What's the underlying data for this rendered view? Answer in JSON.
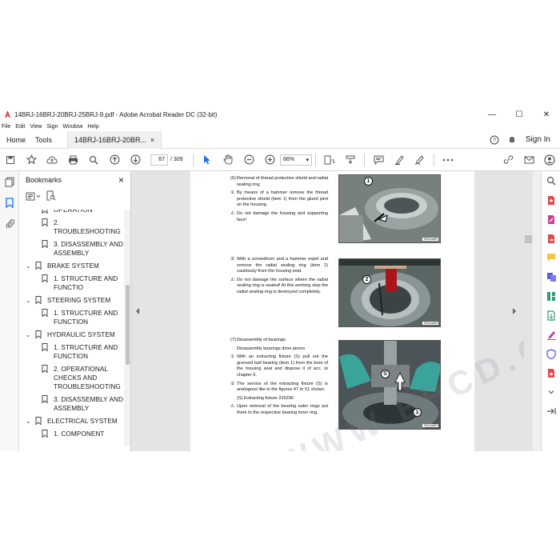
{
  "window": {
    "title": "14BRJ-16BRJ-20BRJ-25BRJ-9.pdf - Adobe Acrobat Reader DC (32-bit)",
    "controls": {
      "minimize": "—",
      "maximize": "☐",
      "close": "✕"
    }
  },
  "menu": [
    "File",
    "Edit",
    "View",
    "Sign",
    "Window",
    "Help"
  ],
  "tabs": {
    "home": "Home",
    "tools": "Tools",
    "document": "14BRJ-16BRJ-20BR...",
    "document_close": "×",
    "signin": "Sign In"
  },
  "toolbar": {
    "page_current": "67",
    "page_total": "/ 309",
    "zoom": "66%"
  },
  "bookmarks": {
    "title": "Bookmarks",
    "close": "×",
    "items": [
      {
        "level": 2,
        "label": "OPERATION"
      },
      {
        "level": 2,
        "label": "2. TROUBLESHOOTING"
      },
      {
        "level": 2,
        "label": "3. DISASSEMBLY AND ASSEMBLY"
      },
      {
        "level": 1,
        "label": "BRAKE SYSTEM"
      },
      {
        "level": 2,
        "label": "1. STRUCTURE AND FUNCTIO"
      },
      {
        "level": 1,
        "label": "STEERING SYSTEM"
      },
      {
        "level": 2,
        "label": "1. STRUCTURE AND FUNCTION"
      },
      {
        "level": 1,
        "label": "HYDRAULIC SYSTEM"
      },
      {
        "level": 2,
        "label": "1. STRUCTURE AND FUNCTION"
      },
      {
        "level": 2,
        "label": "2. OPERATIONAL CHECKS AND TROUBLESHOOTING"
      },
      {
        "level": 2,
        "label": "3. DISASSEMBLY AND ASSEMBLY"
      },
      {
        "level": 1,
        "label": "ELECTRICAL SYSTEM"
      },
      {
        "level": 2,
        "label": "1. COMPONENT"
      }
    ]
  },
  "document": {
    "watermark": "WWW.EPCD.COM",
    "blocks": [
      {
        "bullet": "(6)",
        "text": "Removal of thread protective shield and radial sealing ring"
      },
      {
        "bullet": "①",
        "text": "By means of a hammer remove the thread protective shield (item 1) from the glued joint on the housing."
      },
      {
        "bullet": "⚠",
        "text": "Do not damage the housing and supporting face!"
      },
      {
        "bullet": "②",
        "text": "With a screwdriver and a hammer expel and remove the radial sealing ring (item 2) cautiously from the housing seat."
      },
      {
        "bullet": "⚠",
        "text": "Do not damage the surface where the radial sealing ring is seated! At this working step the radial sealing ring is destroyed completely."
      },
      {
        "bullet": "(7)",
        "text": "Disassembly of bearings"
      },
      {
        "bullet": "",
        "text": "Disassembly bearings drive pinion"
      },
      {
        "bullet": "①",
        "text": "With an extracting fixture (S) pull out the grooved ball bearing (item 1) from the bore of the housing seat and dispose it of acc. to chapter 6."
      },
      {
        "bullet": "②",
        "text": "The service of the extracting fixture (S) is analogous like in the figures 47 to 51 shown."
      },
      {
        "bullet": "",
        "text": "(S) Extracting fixture 225296"
      },
      {
        "bullet": "⚠",
        "text": "Upon removal of the bearing outer rings put them to the respective bearing inner ring."
      }
    ],
    "photos": [
      {
        "callouts": [
          "1"
        ],
        "stamp": "7B0A3ABR"
      },
      {
        "callouts": [
          "2"
        ],
        "stamp": "7B0A3ABR"
      },
      {
        "callouts": [
          "S",
          "1"
        ],
        "stamp": "7B0A3ABR"
      }
    ]
  },
  "colors": {
    "accent": "#1473e6",
    "photo_dark": "#3a3d40",
    "photo_teal": "#3aa39a"
  }
}
